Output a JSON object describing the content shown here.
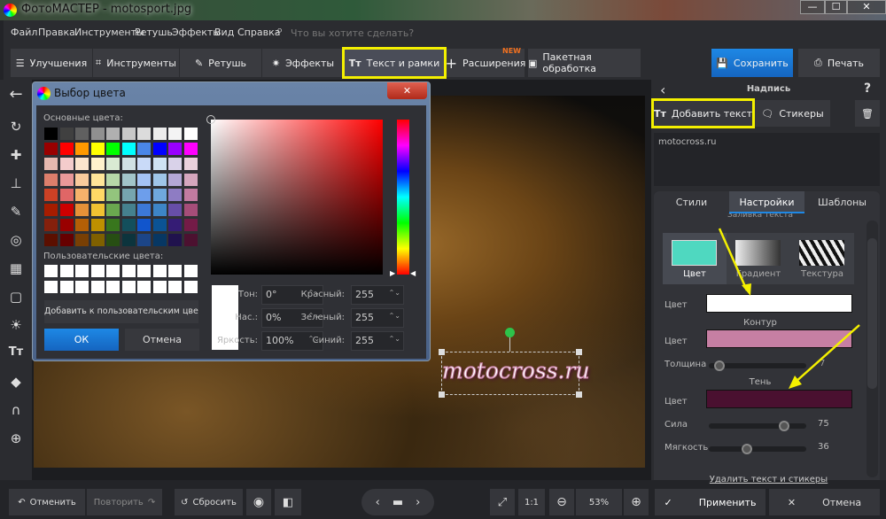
{
  "window": {
    "title": "ФотоМАСТЕР - motosport.jpg",
    "min": "—",
    "max": "☐",
    "close": "✕"
  },
  "menu": {
    "items": [
      "Файл",
      "Правка",
      "Инструменты",
      "Ретушь",
      "Эффекты",
      "Вид",
      "Справка"
    ],
    "search_placeholder": "Что вы хотите сделать?"
  },
  "toolbar": {
    "tabs": [
      {
        "label": "Улучшения",
        "icon": "sliders-icon"
      },
      {
        "label": "Инструменты",
        "icon": "crop-icon"
      },
      {
        "label": "Ретушь",
        "icon": "brush-icon"
      },
      {
        "label": "Эффекты",
        "icon": "magic-wand-icon"
      },
      {
        "label": "Текст и рамки",
        "icon": "text-icon"
      },
      {
        "label": "Расширения",
        "icon": "plus-icon",
        "badge": "NEW"
      },
      {
        "label": "Пакетная обработка",
        "icon": "images-icon"
      }
    ],
    "save": "Сохранить",
    "print": "Печать"
  },
  "dialog": {
    "title": "Выбор цвета",
    "basic_label": "Основные цвета:",
    "custom_label": "Пользовательские цвета:",
    "add_custom": "Добавить к пользовательским цветам",
    "ok": "ОК",
    "cancel": "Отмена",
    "fields": {
      "hue_label": "Тон:",
      "hue": "0°",
      "sat_label": "Нас.:",
      "sat": "0%",
      "val_label": "Яркость:",
      "val": "100%",
      "red_label": "Красный:",
      "red": "255",
      "green_label": "Зеленый:",
      "green": "255",
      "blue_label": "Синий:",
      "blue": "255"
    },
    "current_color": "#ffffff",
    "palette": [
      [
        "#000000",
        "#404040",
        "#606060",
        "#909090",
        "#b0b0b0",
        "#c8c8c8",
        "#dcdcdc",
        "#ececec",
        "#f4f4f4",
        "#ffffff"
      ],
      [
        "#990000",
        "#ff0000",
        "#ff9900",
        "#ffff00",
        "#00ff00",
        "#00ffff",
        "#4a86e8",
        "#0000ff",
        "#9900ff",
        "#ff00ff"
      ],
      [
        "#e6b8af",
        "#f4cccc",
        "#fce5cd",
        "#fff2cc",
        "#d9ead3",
        "#d0e0e3",
        "#c9daf8",
        "#cfe2f3",
        "#d9d2e9",
        "#ead1dc"
      ],
      [
        "#dd7e6b",
        "#ea9999",
        "#f9cb9c",
        "#ffe599",
        "#b6d7a8",
        "#a2c4c9",
        "#a4c2f4",
        "#9fc5e8",
        "#b4a7d6",
        "#d5a6bd"
      ],
      [
        "#cc4125",
        "#e06666",
        "#f6b26b",
        "#ffd966",
        "#93c47d",
        "#76a5af",
        "#6d9eeb",
        "#6fa8dc",
        "#8e7cc3",
        "#c27ba0"
      ],
      [
        "#a61c00",
        "#cc0000",
        "#e69138",
        "#f1c232",
        "#6aa84f",
        "#45818e",
        "#3c78d8",
        "#3d85c6",
        "#674ea7",
        "#a64d79"
      ],
      [
        "#85200c",
        "#990000",
        "#b45f06",
        "#bf9000",
        "#38761d",
        "#134f5c",
        "#1155cc",
        "#0b5394",
        "#351c75",
        "#741b47"
      ],
      [
        "#5b0f00",
        "#660000",
        "#783f04",
        "#7f6000",
        "#274e13",
        "#0c343d",
        "#1c4587",
        "#073763",
        "#20124d",
        "#4c1130"
      ]
    ]
  },
  "canvas": {
    "text": "motocross.ru"
  },
  "right": {
    "title": "Надпись",
    "help": "?",
    "add_text": "Добавить текст",
    "stickers": "Стикеры",
    "text_value": "motocross.ru",
    "tabs": [
      "Стили",
      "Настройки",
      "Шаблоны"
    ],
    "active_tab": 1,
    "fill_header": "Заливка текста",
    "fill_types": [
      "Цвет",
      "Градиент",
      "Текстура"
    ],
    "fill_color": "#4fd8c0",
    "color_label": "Цвет",
    "text_color": "#ffffff",
    "outline_header": "Контур",
    "outline_color": "#c67fa3",
    "thickness_label": "Толщина",
    "thickness": "7",
    "thickness_pct": 5,
    "shadow_header": "Тень",
    "shadow_color": "#4a1030",
    "strength_label": "Сила",
    "strength": "75",
    "strength_pct": 75,
    "softness_label": "Мягкость",
    "softness": "36",
    "softness_pct": 36,
    "delete_link": "Удалить текст и стикеры",
    "apply": "Применить",
    "cancel": "Отмена"
  },
  "bottom": {
    "undo": "Отменить",
    "redo": "Повторить",
    "reset": "Сбросить",
    "one_to_one": "1:1",
    "zoom": "53%"
  },
  "colors": {
    "accent": "#1e88e5",
    "highlight": "#f4f000"
  }
}
